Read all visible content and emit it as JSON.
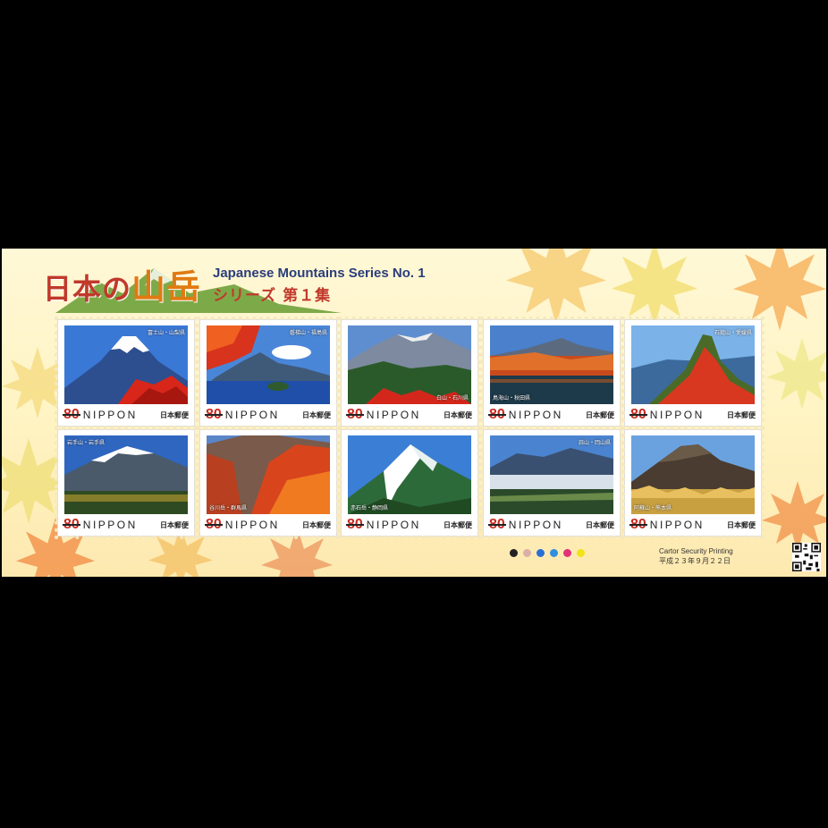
{
  "sheet": {
    "title_jp_prefix": "日本の",
    "title_jp_highlight": "山岳",
    "title_en": "Japanese Mountains Series No. 1",
    "title_series": "シリーズ 第１集",
    "printer": "Cartor Security Printing",
    "date": "平成２３年９月２２日",
    "color_dots": [
      "#222222",
      "#d9b0a8",
      "#2a6fd6",
      "#2f8fe0",
      "#e0337a",
      "#f2e21a"
    ]
  },
  "stamp_common": {
    "value": "80",
    "country": "NIPPON",
    "post": "日本郵便"
  },
  "stamps": [
    {
      "caption": "富士山・山梨県",
      "cap_pos": "tr",
      "scene": "fuji"
    },
    {
      "caption": "磐梯山・福島県",
      "cap_pos": "tr",
      "scene": "lake"
    },
    {
      "caption": "白山・石川県",
      "cap_pos": "br",
      "scene": "valley"
    },
    {
      "caption": "鳥海山・秋田県",
      "cap_pos": "bl",
      "scene": "autumnlake"
    },
    {
      "caption": "石鎚山・愛媛県",
      "cap_pos": "tr",
      "scene": "ridge"
    },
    {
      "caption": "岩手山・岩手県",
      "cap_pos": "tl",
      "scene": "snowy"
    },
    {
      "caption": "谷川岳・群馬県",
      "cap_pos": "bl",
      "scene": "gorge"
    },
    {
      "caption": "赤石岳・静岡県",
      "cap_pos": "bl",
      "scene": "alpine"
    },
    {
      "caption": "蒜山・岡山県",
      "cap_pos": "tr",
      "scene": "cloudsea"
    },
    {
      "caption": "阿蘇山・熊本県",
      "cap_pos": "bl",
      "scene": "grass"
    }
  ]
}
